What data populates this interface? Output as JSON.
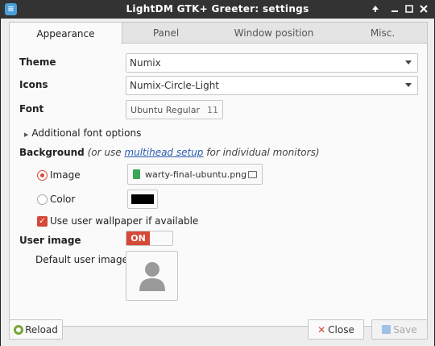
{
  "window": {
    "title": "LightDM GTK+ Greeter: settings",
    "app_icon_glyph": "≡"
  },
  "tabs": [
    {
      "label": "Appearance",
      "active": true
    },
    {
      "label": "Panel",
      "active": false
    },
    {
      "label": "Window position",
      "active": false
    },
    {
      "label": "Misc.",
      "active": false
    }
  ],
  "appearance": {
    "theme_label": "Theme",
    "theme_value": "Numix",
    "icons_label": "Icons",
    "icons_value": "Numix-Circle-Light",
    "font_label": "Font",
    "font_name": "Ubuntu Regular",
    "font_size": "11",
    "additional_font_options": "Additional font options",
    "background_label": "Background",
    "background_hint_pre": "(or use ",
    "background_hint_link": "multihead setup",
    "background_hint_post": " for individual monitors)",
    "image_option_label": "Image",
    "image_file": "warty-final-ubuntu.png",
    "color_option_label": "Color",
    "color_value": "#000000",
    "user_wallpaper_label": "Use user wallpaper if available",
    "user_image_label": "User image",
    "user_image_toggle": "ON",
    "default_user_image_label": "Default user image"
  },
  "footer": {
    "reload_label": "Reload",
    "close_label": "Close",
    "save_label": "Save"
  },
  "colors": {
    "accent": "#d64937",
    "titlebar": "#333333",
    "link": "#2a5db0"
  }
}
